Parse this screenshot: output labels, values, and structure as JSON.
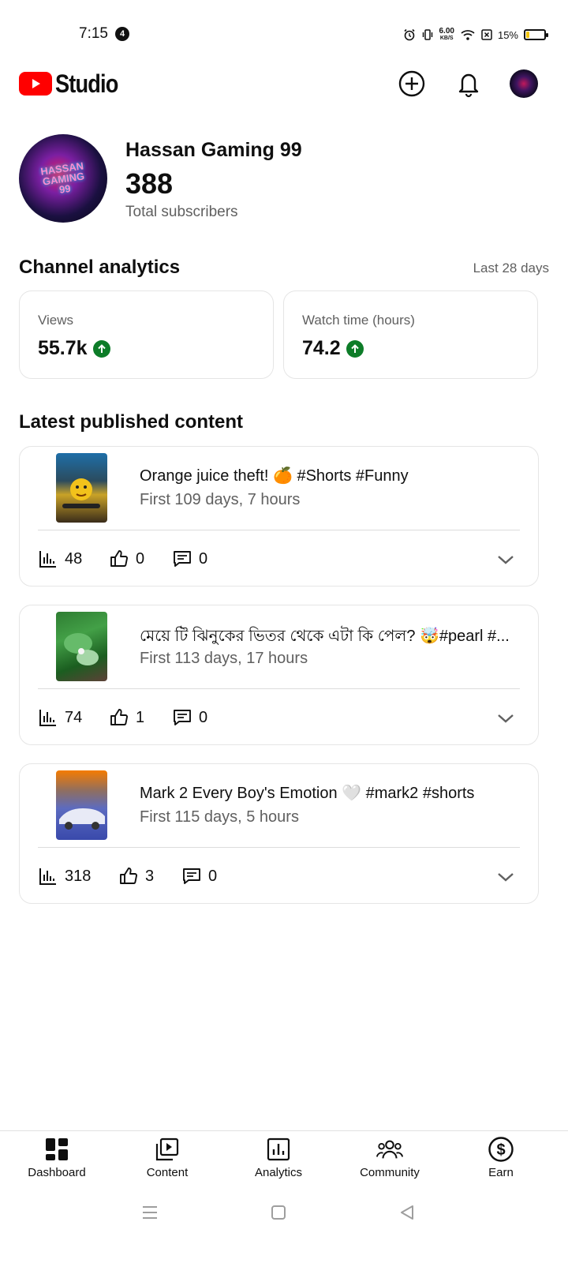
{
  "status_bar": {
    "time": "7:15",
    "notification_count": "4",
    "net_speed_value": "6.00",
    "net_speed_unit": "KB/S",
    "battery_percent": "15%",
    "battery_level": 0.15
  },
  "header": {
    "logo_text": "Studio",
    "icons": [
      "create-icon",
      "notifications-icon",
      "account-avatar"
    ]
  },
  "channel": {
    "name": "Hassan Gaming 99",
    "subscribers": "388",
    "subscribers_label": "Total subscribers",
    "avatar_text": "HASSAN GAMING 99"
  },
  "analytics": {
    "title": "Channel analytics",
    "period": "Last 28 days",
    "views_label": "Views",
    "views_value": "55.7k",
    "watch_label": "Watch time (hours)",
    "watch_value": "74.2"
  },
  "latest": {
    "title": "Latest published content",
    "items": [
      {
        "title": "Orange juice theft! 🍊 #Shorts #Funny",
        "age": "First 109 days, 7 hours",
        "views": "48",
        "likes": "0",
        "comments": "0"
      },
      {
        "title": "মেয়ে টি ঝিনুকের ভিতর থেকে এটা কি পেল? 🤯#pearl #...",
        "age": "First 113 days, 17 hours",
        "views": "74",
        "likes": "1",
        "comments": "0"
      },
      {
        "title": "Mark 2 Every Boy's Emotion 🤍 #mark2 #shorts",
        "age": "First 115 days, 5 hours",
        "views": "318",
        "likes": "3",
        "comments": "0"
      }
    ]
  },
  "bottom_nav": {
    "dashboard": "Dashboard",
    "content": "Content",
    "analytics": "Analytics",
    "community": "Community",
    "earn": "Earn"
  },
  "colors": {
    "brand_red": "#ff0000",
    "trend_green": "#0d7c28",
    "secondary_text": "#606060"
  }
}
